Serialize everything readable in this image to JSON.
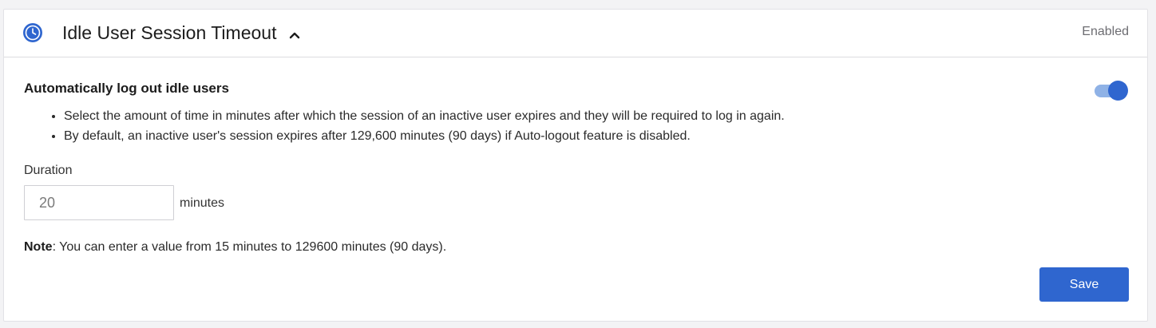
{
  "header": {
    "icon": "clock-icon",
    "title": "Idle User Session Timeout",
    "caret_icon": "chevron-up-icon",
    "status": "Enabled"
  },
  "section": {
    "heading": "Automatically log out idle users",
    "toggle_enabled": true,
    "bullets": [
      "Select the amount of time in minutes after which the session of an inactive user expires and they will be required to log in again.",
      "By default, an inactive user's session expires after 129,600 minutes (90 days) if Auto-logout feature is disabled."
    ]
  },
  "duration": {
    "label": "Duration",
    "value": "20",
    "unit": "minutes"
  },
  "note": {
    "prefix": "Note",
    "text": ": You can enter a value from 15 minutes to 129600 minutes (90 days)."
  },
  "actions": {
    "save_label": "Save"
  },
  "colors": {
    "accent": "#2f66cf",
    "toggle_track": "#8fb2e6",
    "status_text": "#6d6d72"
  }
}
